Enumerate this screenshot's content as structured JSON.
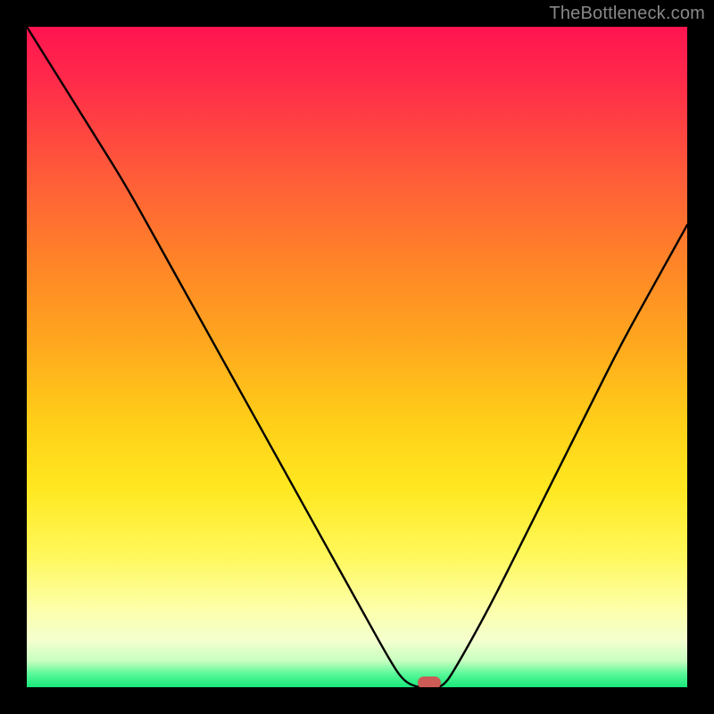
{
  "attribution": "TheBottleneck.com",
  "chart_data": {
    "type": "line",
    "title": "",
    "xlabel": "",
    "ylabel": "",
    "xlim": [
      0,
      100
    ],
    "ylim": [
      0,
      100
    ],
    "grid": false,
    "legend": false,
    "series": [
      {
        "name": "bottleneck-curve",
        "x": [
          0,
          5,
          10,
          15,
          20,
          25,
          30,
          35,
          40,
          45,
          50,
          55,
          57,
          59,
          61,
          63,
          65,
          70,
          75,
          80,
          85,
          90,
          95,
          100
        ],
        "y": [
          100,
          92,
          84,
          76,
          67,
          58,
          49,
          40,
          31,
          22,
          13,
          4,
          1,
          0,
          0,
          0,
          3,
          12,
          22,
          32,
          42,
          52,
          61,
          70
        ]
      }
    ],
    "marker": {
      "x": 61,
      "y": 0,
      "color": "#cc5a55"
    },
    "background_gradient": {
      "direction": "vertical",
      "stops": [
        {
          "pos": 0,
          "color": "#ff1450"
        },
        {
          "pos": 8,
          "color": "#ff2a4a"
        },
        {
          "pos": 22,
          "color": "#ff5a3a"
        },
        {
          "pos": 35,
          "color": "#ff8228"
        },
        {
          "pos": 48,
          "color": "#ffa81e"
        },
        {
          "pos": 60,
          "color": "#ffcf18"
        },
        {
          "pos": 70,
          "color": "#ffe821"
        },
        {
          "pos": 80,
          "color": "#fff85a"
        },
        {
          "pos": 88,
          "color": "#fdffa8"
        },
        {
          "pos": 93,
          "color": "#f3ffcf"
        },
        {
          "pos": 96,
          "color": "#c8ffc0"
        },
        {
          "pos": 98,
          "color": "#58f898"
        },
        {
          "pos": 100,
          "color": "#18e77a"
        }
      ]
    }
  }
}
